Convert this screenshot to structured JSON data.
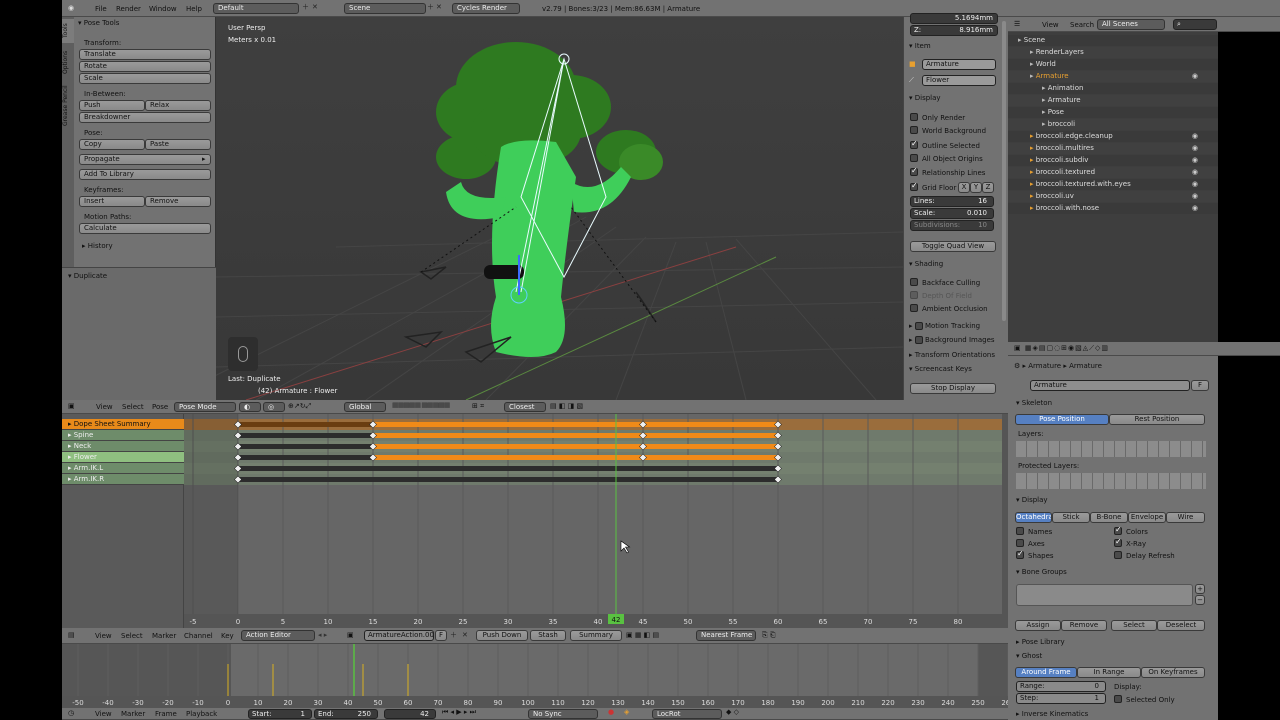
{
  "topbar": {
    "menus": [
      "File",
      "Render",
      "Window",
      "Help"
    ],
    "layout": "Default",
    "scene": "Scene",
    "engine": "Cycles Render",
    "stats": "v2.79 | Bones:3/23 | Mem:86.63M | Armature"
  },
  "tools": {
    "tabs": [
      "Tools",
      "Options",
      "Grease Pencil"
    ],
    "title": "Pose Tools",
    "transform_label": "Transform:",
    "translate": "Translate",
    "rotate": "Rotate",
    "scale": "Scale",
    "inbetween_label": "In-Between:",
    "push": "Push",
    "relax": "Relax",
    "breakdowner": "Breakdowner",
    "pose_label": "Pose:",
    "copy": "Copy",
    "paste": "Paste",
    "propagate": "Propagate",
    "add_to_library": "Add To Library",
    "keyframes_label": "Keyframes:",
    "insert": "Insert",
    "remove": "Remove",
    "motion_paths_label": "Motion Paths:",
    "calculate": "Calculate",
    "history": "History",
    "duplicate": "Duplicate"
  },
  "viewport": {
    "view_name": "User Persp",
    "units": "Meters x 0.01",
    "last_op": "Last: Duplicate",
    "object_info": "(42) Armature : Flower"
  },
  "npanel": {
    "top_value": "5.1694mm",
    "z_label": "Z:",
    "z_value": "8.916mm",
    "item_title": "Item",
    "object_name": "Armature",
    "bone_name": "Flower",
    "display_title": "Display",
    "only_render": "Only Render",
    "world_background": "World Background",
    "outline_selected": "Outline Selected",
    "all_object_origins": "All Object Origins",
    "relationship_lines": "Relationship Lines",
    "grid_floor": "Grid Floor",
    "x": "X",
    "y": "Y",
    "z": "Z",
    "lines_label": "Lines:",
    "lines_value": "16",
    "scale_label": "Scale:",
    "scale_value": "0.010",
    "subdivisions_label": "Subdivisions:",
    "subdivisions_value": "10",
    "toggle_quad": "Toggle Quad View",
    "shading_title": "Shading",
    "backface_culling": "Backface Culling",
    "depth_of_field": "Depth Of Field",
    "ambient_occlusion": "Ambient Occlusion",
    "motion_tracking": "Motion Tracking",
    "background_images": "Background Images",
    "transform_orientations": "Transform Orientations",
    "screencast_keys": "Screencast Keys",
    "stop_display": "Stop Display"
  },
  "viewhdr": {
    "view": "View",
    "select": "Select",
    "pose": "Pose",
    "mode": "Pose Mode",
    "orientation": "Global",
    "snap": "Closest"
  },
  "outliner": {
    "view": "View",
    "search": "Search",
    "filter": "All Scenes",
    "items": [
      {
        "label": "Scene",
        "indent": 0
      },
      {
        "label": "RenderLayers",
        "indent": 1
      },
      {
        "label": "World",
        "indent": 1
      },
      {
        "label": "Armature",
        "indent": 1
      },
      {
        "label": "Animation",
        "indent": 2
      },
      {
        "label": "Armature",
        "indent": 2
      },
      {
        "label": "Pose",
        "indent": 2
      },
      {
        "label": "broccoli",
        "indent": 2
      },
      {
        "label": "broccoli.edge.cleanup",
        "indent": 1
      },
      {
        "label": "broccoli.multires",
        "indent": 1
      },
      {
        "label": "broccoli.subdiv",
        "indent": 1
      },
      {
        "label": "broccoli.textured",
        "indent": 1
      },
      {
        "label": "broccoli.textured.with.eyes",
        "indent": 1
      },
      {
        "label": "broccoli.uv",
        "indent": 1
      },
      {
        "label": "broccoli.with.nose",
        "indent": 1
      }
    ]
  },
  "props": {
    "crumb_armature": "Armature",
    "crumb_data": "Armature",
    "data_name": "Armature",
    "users": "F",
    "skeleton": "Skeleton",
    "pose_position": "Pose Position",
    "rest_position": "Rest Position",
    "layers": "Layers:",
    "protected_layers": "Protected Layers:",
    "display": "Display",
    "octahedral": "Octahedral",
    "stick": "Stick",
    "bbone": "B-Bone",
    "envelope": "Envelope",
    "wire": "Wire",
    "names": "Names",
    "colors": "Colors",
    "axes": "Axes",
    "xray": "X-Ray",
    "shapes": "Shapes",
    "delay_refresh": "Delay Refresh",
    "bone_groups": "Bone Groups",
    "assign": "Assign",
    "remove": "Remove",
    "select": "Select",
    "deselect": "Deselect",
    "pose_library": "Pose Library",
    "ghost": "Ghost",
    "around_frame": "Around Frame",
    "in_range": "In Range",
    "on_keyframes": "On Keyframes",
    "range_label": "Range:",
    "range_value": "0",
    "step_label": "Step:",
    "step_value": "1",
    "display_label": "Display:",
    "selected_only": "Selected Only",
    "inverse_kinematics": "Inverse Kinematics"
  },
  "dopesheet": {
    "channels": [
      {
        "name": "Dope Sheet Summary",
        "type": "summary"
      },
      {
        "name": "Spine",
        "type": "bone"
      },
      {
        "name": "Neck",
        "type": "bone"
      },
      {
        "name": "Flower",
        "type": "bone-sel"
      },
      {
        "name": "Arm.IK.L",
        "type": "bone"
      },
      {
        "name": "Arm.IK.R",
        "type": "bone"
      }
    ],
    "ruler": [
      "-5",
      "0",
      "5",
      "10",
      "15",
      "20",
      "25",
      "30",
      "35",
      "40",
      "45",
      "50",
      "55",
      "60",
      "65",
      "70",
      "75",
      "80"
    ],
    "current_frame": "42",
    "menus": [
      "View",
      "Select",
      "Marker",
      "Channel",
      "Key"
    ],
    "mode": "Action Editor",
    "action": "ArmatureAction.001",
    "fake": "F",
    "push_down": "Push Down",
    "stash": "Stash",
    "summary": "Summary",
    "snap": "Nearest Frame"
  },
  "timeline": {
    "ruler": [
      "-50",
      "-40",
      "-30",
      "-20",
      "-10",
      "0",
      "10",
      "20",
      "30",
      "40",
      "50",
      "60",
      "70",
      "80",
      "90",
      "100",
      "110",
      "120",
      "130",
      "140",
      "150",
      "160",
      "170",
      "180",
      "190",
      "200",
      "210",
      "220",
      "230",
      "240",
      "250",
      "260",
      "270",
      "280"
    ],
    "menus": [
      "View",
      "Marker",
      "Frame",
      "Playback"
    ],
    "start_label": "Start:",
    "start": "1",
    "end_label": "End:",
    "end": "250",
    "frame": "42",
    "sync": "No Sync",
    "keying": "LocRot"
  },
  "colors": {
    "orange": "#e88a1a",
    "accent": "#5680c2",
    "green_line": "#59c141"
  }
}
